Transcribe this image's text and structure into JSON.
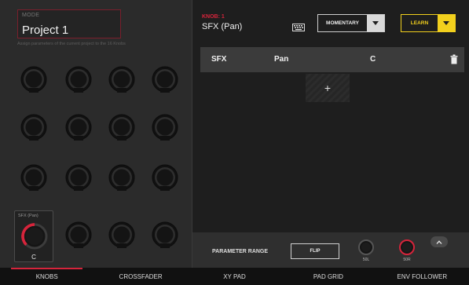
{
  "left_panel": {
    "mode_label": "MODE",
    "mode_value": "Project 1",
    "hint": "Assign parameters of the current project to the 16 Knobs",
    "selected_knob": {
      "title": "SFX (Pan)",
      "value": "C"
    }
  },
  "knob_editor": {
    "knob_number": "KNOB: 1",
    "knob_name": "SFX (Pan)",
    "keyboard_icon": "keyboard-icon",
    "mode_dropdown": "MOMENTARY",
    "learn_label": "LEARN"
  },
  "param_row": {
    "columns": [
      "SFX",
      "Pan",
      "C"
    ],
    "delete_icon": "trash-icon"
  },
  "add_label": "+",
  "range": {
    "label": "PARAMETER RANGE",
    "flip_label": "FLIP",
    "min_label": "50L",
    "max_label": "50R"
  },
  "tabs": [
    "KNOBS",
    "CROSSFADER",
    "XY PAD",
    "PAD GRID",
    "ENV FOLLOWER"
  ],
  "active_tab": "KNOBS",
  "colors": {
    "accent": "#d6243b",
    "learn": "#f2d01d"
  }
}
